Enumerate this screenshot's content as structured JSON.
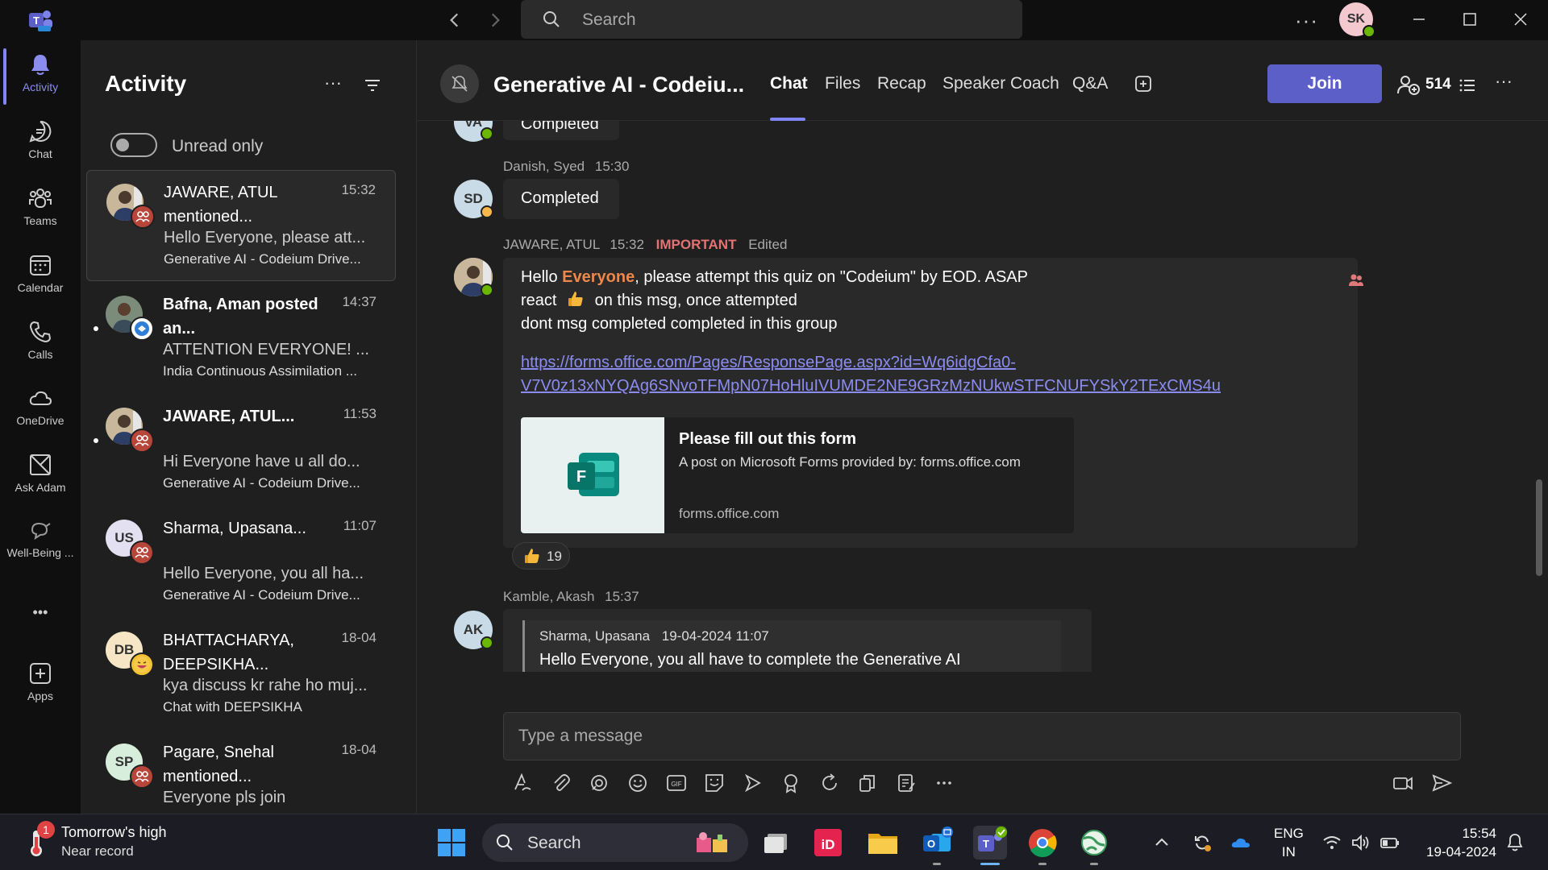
{
  "titlebar": {
    "search_placeholder": "Search",
    "more_label": "···",
    "avatar_initials": "SK"
  },
  "rail": {
    "items": [
      {
        "label": "Activity",
        "icon": "bell-icon"
      },
      {
        "label": "Chat",
        "icon": "chat-icon"
      },
      {
        "label": "Teams",
        "icon": "teams-icon"
      },
      {
        "label": "Calendar",
        "icon": "calendar-icon"
      },
      {
        "label": "Calls",
        "icon": "phone-icon"
      },
      {
        "label": "OneDrive",
        "icon": "cloud-icon"
      },
      {
        "label": "Ask Adam",
        "icon": "ask-adam-icon"
      },
      {
        "label": "Well-Being ...",
        "icon": "wellbeing-icon"
      }
    ],
    "more_label": "•••",
    "apps_label": "Apps"
  },
  "activity": {
    "title": "Activity",
    "more_label": "···",
    "unread_only_label": "Unread only",
    "items": [
      {
        "name": "JAWARE, ATUL mentioned...",
        "time": "15:32",
        "preview": "Hello Everyone, please att...",
        "source": "Generative AI - Codeium Drive...",
        "avatar": "",
        "badge_color": "#b8453a",
        "bold": false,
        "unread": false,
        "selected": true
      },
      {
        "name": "Bafna, Aman posted an...",
        "time": "14:37",
        "preview": "ATTENTION EVERYONE! ...",
        "source": "India Continuous Assimilation ...",
        "avatar": "",
        "badge_color": "#2f7fd8",
        "bold": true,
        "unread": true,
        "selected": false
      },
      {
        "name": "JAWARE, ATUL...",
        "time": "11:53",
        "preview": "Hi Everyone have u all do...",
        "source": "Generative AI - Codeium Drive...",
        "avatar": "",
        "badge_color": "#b8453a",
        "bold": true,
        "unread": true,
        "selected": false
      },
      {
        "name": "Sharma, Upasana...",
        "time": "11:07",
        "preview": "Hello Everyone, you all ha...",
        "source": "Generative AI - Codeium Drive...",
        "avatar": "US",
        "badge_color": "#b8453a",
        "bold": false,
        "unread": false,
        "selected": false
      },
      {
        "name": "BHATTACHARYA, DEEPSIKHA...",
        "time": "18-04",
        "preview": "kya discuss kr rahe ho muj...",
        "source": "Chat with DEEPSIKHA",
        "avatar": "DB",
        "badge_color": "#f1c232",
        "bold": false,
        "unread": false,
        "selected": false
      },
      {
        "name": "Pagare, Snehal mentioned...",
        "time": "18-04",
        "preview": "Everyone pls join",
        "source": "",
        "avatar": "SP",
        "badge_color": "#b8453a",
        "bold": false,
        "unread": false,
        "selected": false
      }
    ]
  },
  "chat": {
    "title": "Generative AI - Codeiu...",
    "tabs": [
      "Chat",
      "Files",
      "Recap",
      "Speaker Coach",
      "Q&A"
    ],
    "join_label": "Join",
    "participant_count": "514",
    "more_label": "···",
    "messages": {
      "top_partial": {
        "text": "Completed",
        "avatar": "VA"
      },
      "m1": {
        "sender": "Danish, Syed",
        "time": "15:30",
        "avatar": "SD",
        "text": "Completed"
      },
      "m2": {
        "sender": "JAWARE, ATUL",
        "time": "15:32",
        "importance": "IMPORTANT",
        "edited": "Edited",
        "line1_pre": "Hello ",
        "mention": "Everyone",
        "line1_post": ", please attempt this quiz on \"Codeium\" by EOD. ASAP",
        "line2_pre": "react ",
        "line2_post": " on this msg, once attempted",
        "line3": "dont msg completed completed in this group",
        "link_line1": "https://forms.office.com/Pages/ResponsePage.aspx?id=Wq6idgCfa0-",
        "link_line2": "V7V0z13xNYQAg6SNvoTFMpN07HoHluIVUMDE2NE9GRzMzNUkwSTFCNUFYSkY2TExCMS4u",
        "preview": {
          "title": "Please fill out this form",
          "description": "A post on Microsoft Forms provided by: forms.office.com",
          "domain": "forms.office.com"
        },
        "reaction_count": "19"
      },
      "m3": {
        "sender": "Kamble, Akash",
        "time": "15:37",
        "avatar": "AK",
        "quote_author": "Sharma, Upasana",
        "quote_time": "19-04-2024 11:07",
        "quote_text": "Hello Everyone, you all have to complete the Generative AI"
      }
    },
    "compose_placeholder": "Type a message"
  },
  "taskbar": {
    "weather_title": "Tomorrow's high",
    "weather_sub": "Near record",
    "weather_badge": "1",
    "search_placeholder": "Search",
    "lang_line1": "ENG",
    "lang_line2": "IN",
    "time": "15:54",
    "date": "19-04-2024"
  },
  "colors": {
    "accent": "#7f85f5",
    "join": "#5b5fc7",
    "mention": "#f0874a",
    "important": "#e57373",
    "presence_available": "#6bb700",
    "presence_away": "#f8b74a"
  }
}
